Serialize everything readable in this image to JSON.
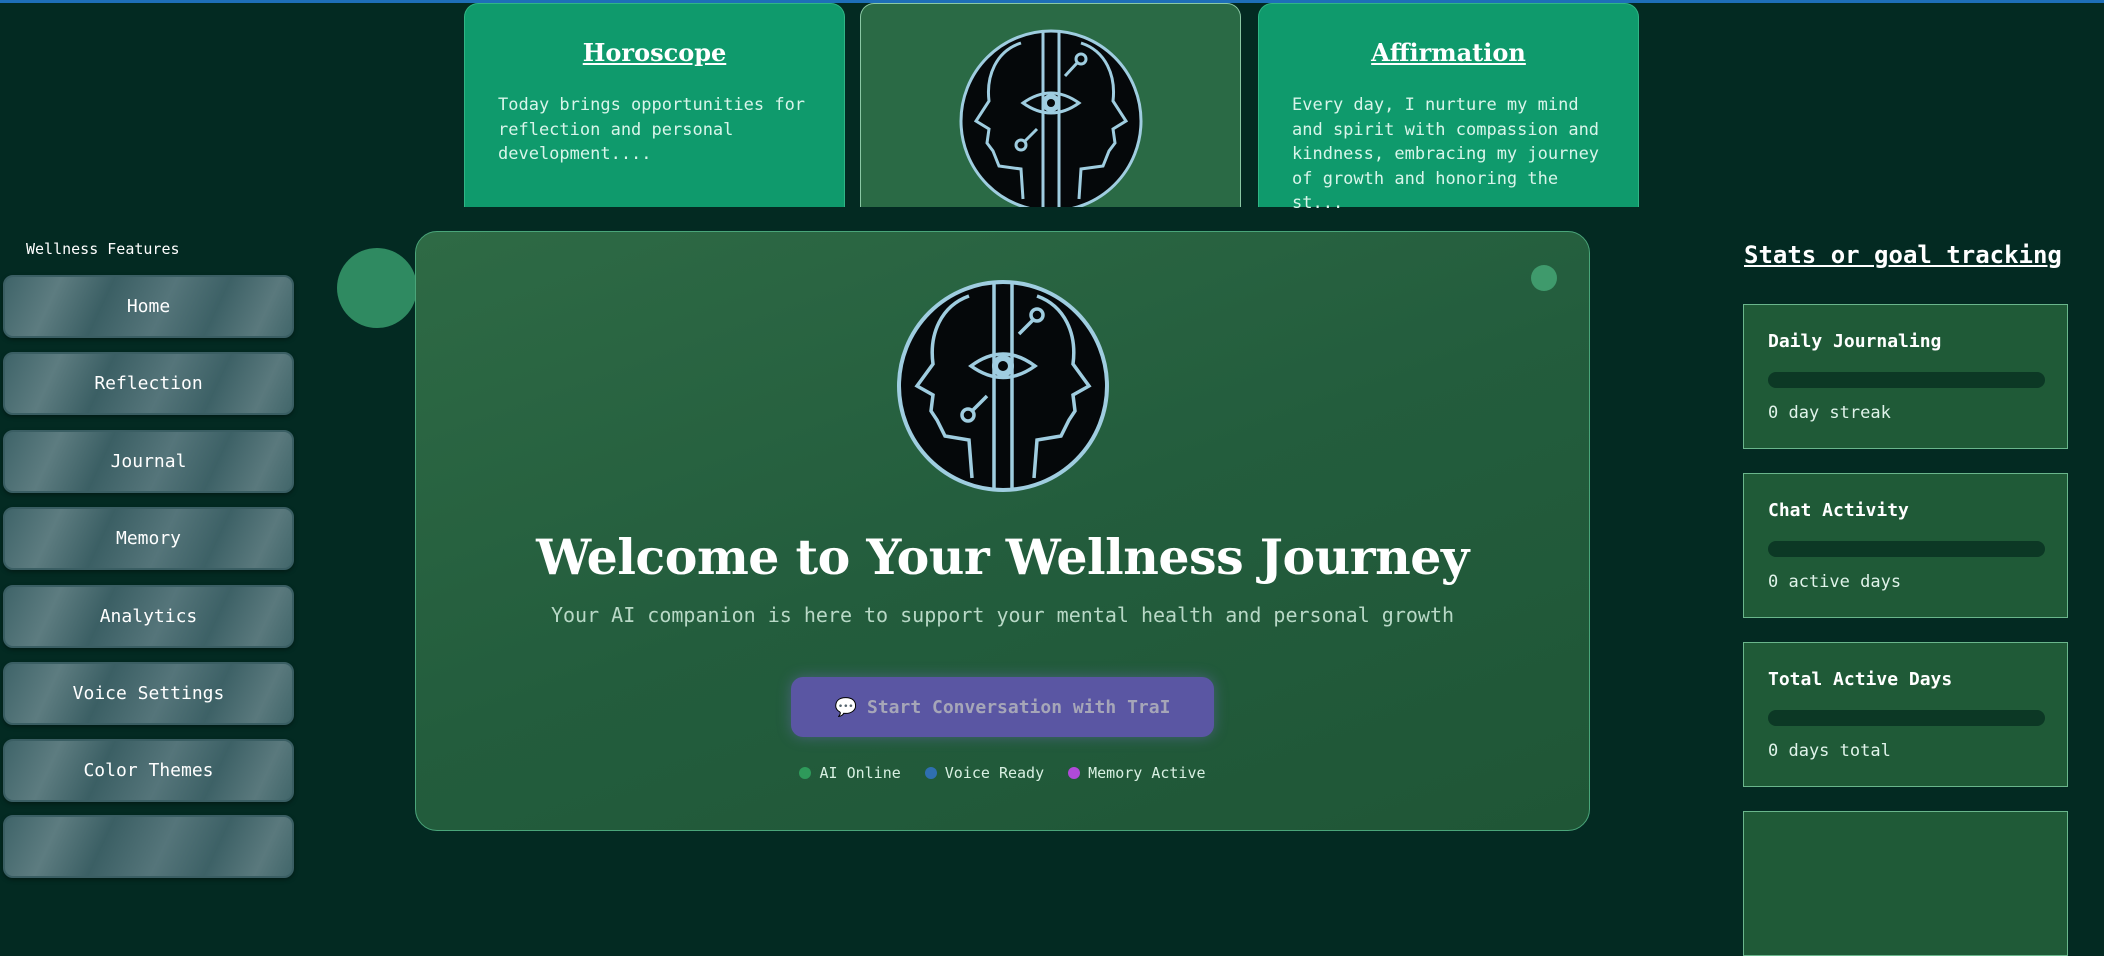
{
  "colors": {
    "background": "#032a22",
    "top_card": "#0f9a6c",
    "main_card": "#265f3e",
    "cta": "#5a56a3",
    "stat_card": "#1f5a37",
    "status_ai": "#2e9a5a",
    "status_voice": "#2f6fb0",
    "status_memory": "#b04ad8"
  },
  "top_cards": {
    "horoscope": {
      "title": "Horoscope",
      "text": "Today brings opportunities for reflection and personal development...."
    },
    "logo_icon": "dual-face-eye-logo-icon",
    "affirmation": {
      "title": "Affirmation",
      "text": "Every day, I nurture my mind and spirit with compassion and kindness, embracing my journey of growth and honoring the st..."
    }
  },
  "sidebar": {
    "title": "Wellness Features",
    "items": [
      {
        "label": "Home"
      },
      {
        "label": "Reflection"
      },
      {
        "label": "Journal"
      },
      {
        "label": "Memory"
      },
      {
        "label": "Analytics"
      },
      {
        "label": "Voice Settings"
      },
      {
        "label": "Color Themes"
      }
    ]
  },
  "main": {
    "title": "Welcome to Your Wellness Journey",
    "subtitle": "Your AI companion is here to support your mental health and personal growth",
    "cta_icon": "💬",
    "cta_label": "Start Conversation with TraI",
    "status": [
      {
        "label": "AI Online"
      },
      {
        "label": "Voice Ready"
      },
      {
        "label": "Memory Active"
      }
    ]
  },
  "stats": {
    "title": "Stats or goal tracking",
    "cards": [
      {
        "title": "Daily Journaling",
        "value": "0 day streak",
        "progress": 0
      },
      {
        "title": "Chat Activity",
        "value": "0 active days",
        "progress": 0
      },
      {
        "title": "Total Active Days",
        "value": "0 days total",
        "progress": 0
      }
    ]
  }
}
